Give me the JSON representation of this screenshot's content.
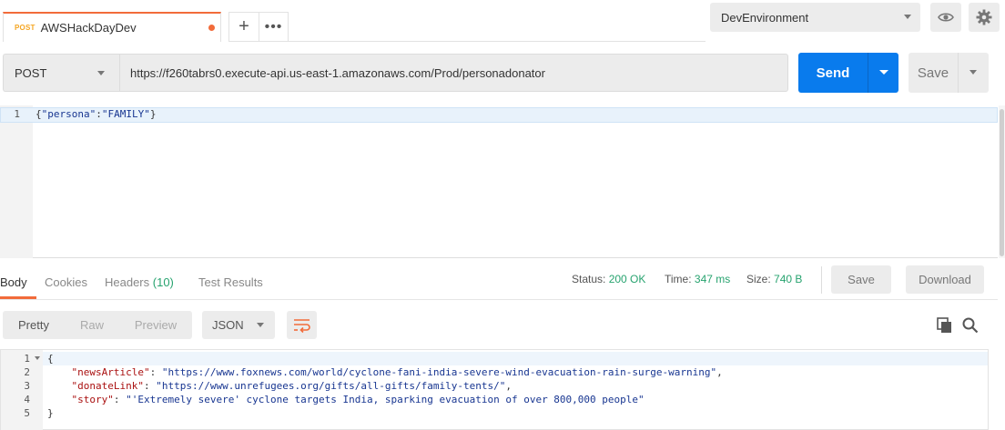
{
  "tab": {
    "method": "POST",
    "title": "AWSHackDayDev",
    "new_tab": "+",
    "more": "•••"
  },
  "environment": {
    "selected": "DevEnvironment",
    "eye_icon": "eye-icon",
    "gear_icon": "gear-icon"
  },
  "request": {
    "method": "POST",
    "url": "https://f260tabrs0.execute-api.us-east-1.amazonaws.com/Prod/personadonator",
    "send_label": "Send",
    "save_label": "Save"
  },
  "request_body": {
    "line_numbers": [
      "1"
    ],
    "line_open": "{",
    "key": "\"persona\"",
    "colon": ":",
    "value": "\"FAMILY\"",
    "line_close": "}"
  },
  "response_tabs": {
    "body": "Body",
    "cookies": "Cookies",
    "headers": "Headers",
    "headers_count": "(10)",
    "test_results": "Test Results"
  },
  "response_meta": {
    "status_label": "Status:",
    "status_value": "200 OK",
    "time_label": "Time:",
    "time_value": "347 ms",
    "size_label": "Size:",
    "size_value": "740 B",
    "save_label": "Save",
    "download_label": "Download"
  },
  "view": {
    "pretty": "Pretty",
    "raw": "Raw",
    "preview": "Preview",
    "format": "JSON",
    "active": "Pretty"
  },
  "response_body": {
    "line_numbers": [
      "1",
      "2",
      "3",
      "4",
      "5"
    ],
    "open": "{",
    "news_key": "\"newsArticle\"",
    "news_value": "\"https://www.foxnews.com/world/cyclone-fani-india-severe-wind-evacuation-rain-surge-warning\"",
    "donate_key": "\"donateLink\"",
    "donate_value": "\"https://www.unrefugees.org/gifts/all-gifts/family-tents/\"",
    "story_key": "\"story\"",
    "story_value": "\"'Extremely severe' cyclone targets India, sparking evacuation of over 800,000 people\"",
    "close": "}"
  },
  "colors": {
    "accent": "#f26b3a",
    "primary": "#097bed",
    "success": "#27a36f"
  }
}
